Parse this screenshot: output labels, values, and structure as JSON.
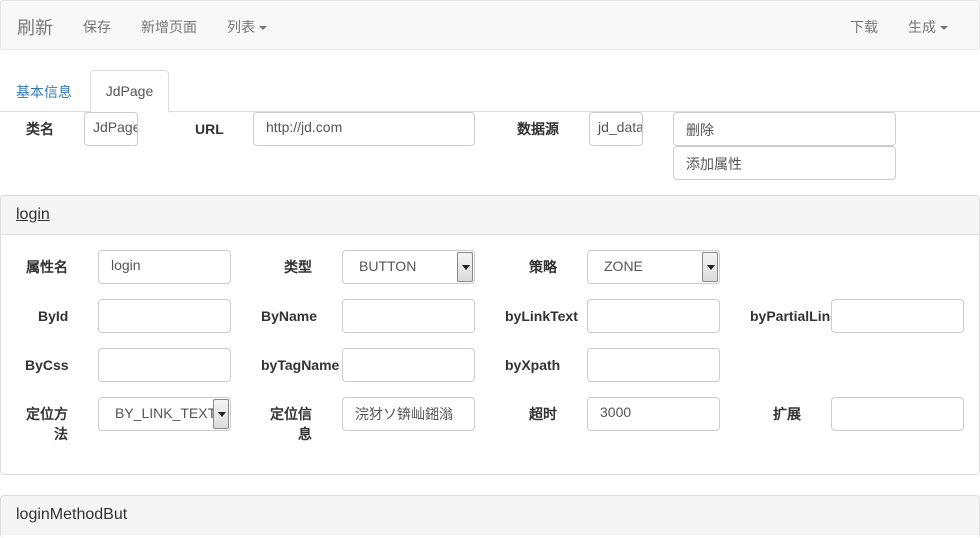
{
  "navbar": {
    "brand": "刷新",
    "save": "保存",
    "new_page": "新增页面",
    "list": "列表",
    "download": "下载",
    "generate": "生成"
  },
  "tabs": {
    "basic_info": "基本信息",
    "jdpage": "JdPage"
  },
  "class_form": {
    "class_name_label": "类名",
    "class_name_value": "JdPage",
    "url_label": "URL",
    "url_value": "http://jd.com",
    "datasource_label": "数据源",
    "datasource_value": "jd_data",
    "delete_label": "删除",
    "add_attr_label": "添加属性"
  },
  "panel_login": {
    "title": "login",
    "attr_name_label": "属性名",
    "attr_name_value": "login",
    "type_label": "类型",
    "type_value": "BUTTON",
    "strategy_label": "策略",
    "strategy_value": "ZONE",
    "byid_label": "ById",
    "byid_value": "",
    "byname_label": "ByName",
    "byname_value": "",
    "bylinktext_label": "byLinkText",
    "bylinktext_value": "",
    "bypartiallink_label": "byPartialLin",
    "bypartiallink_value": "",
    "bycss_label": "ByCss",
    "bycss_value": "",
    "bytagname_label": "byTagName",
    "bytagname_value": "",
    "byxpath_label": "byXpath",
    "byxpath_value": "",
    "locate_method_label_1": "定位方",
    "locate_method_label_2": "法",
    "locate_method_value": "BY_LINK_TEXT",
    "locate_info_label_1": "定位信",
    "locate_info_label_2": "息",
    "locate_info_value": "浣犲ソ锛屾鎺滃",
    "timeout_label": "超时",
    "timeout_value": "3000",
    "extend_label": "扩展",
    "extend_value": ""
  },
  "panel_login_method": {
    "title": "loginMethodBut"
  }
}
